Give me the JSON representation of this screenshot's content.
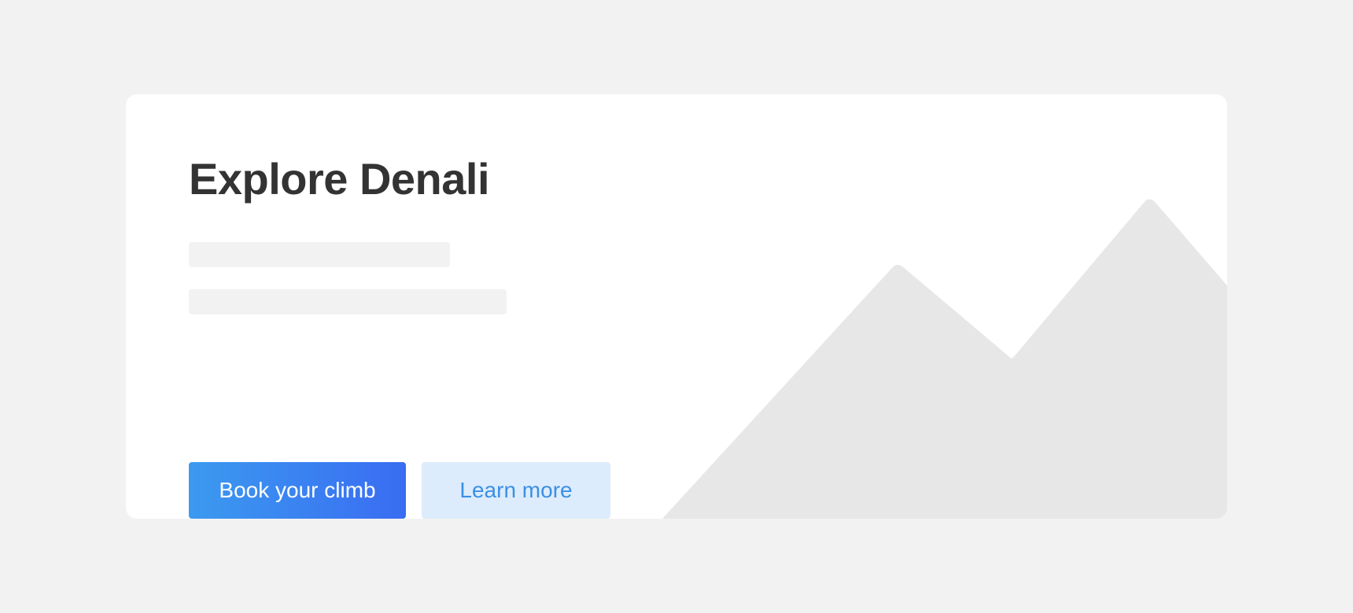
{
  "card": {
    "title": "Explore Denali",
    "primary_button": "Book your climb",
    "secondary_button": "Learn more"
  },
  "colors": {
    "page_background": "#f2f2f2",
    "card_background": "#ffffff",
    "title": "#333333",
    "primary_gradient_start": "#3b9af0",
    "primary_gradient_end": "#3a6cf2",
    "secondary_background": "#ddecfc",
    "secondary_text": "#3b8fe4",
    "mountain_fill": "#e7e7e7",
    "placeholder": "#f2f2f2"
  },
  "icons": {
    "illustration": "mountain-range-illustration"
  }
}
